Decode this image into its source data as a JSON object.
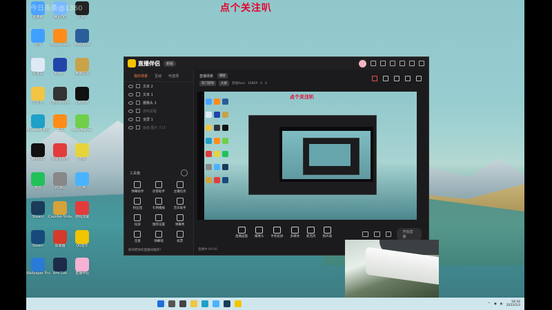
{
  "overlay_text": "点个关注叭",
  "watermark": "今日头条@1360",
  "desktop_icons": [
    {
      "label": "此电脑",
      "color": "#4aa3ff"
    },
    {
      "label": "腾讯QQ",
      "color": "#7ab9ff"
    },
    {
      "label": "CPC",
      "color": "#222"
    },
    {
      "label": "文件",
      "color": "#3fa0ff"
    },
    {
      "label": "DataGuard",
      "color": "#ff8c1a"
    },
    {
      "label": "WeGame",
      "color": "#2a5e9a"
    },
    {
      "label": "回收站",
      "color": "#dfe9f5"
    },
    {
      "label": "Ever...",
      "color": "#2244aa"
    },
    {
      "label": "英雄联盟",
      "color": "#c9a24a"
    },
    {
      "label": "文件夹",
      "color": "#f2c443"
    },
    {
      "label": "OBS Studio",
      "color": "#333"
    },
    {
      "label": "CapCut",
      "color": "#111"
    },
    {
      "label": "Microsoft Edge",
      "color": "#1fa0c9"
    },
    {
      "label": "工具",
      "color": "#ff8c1a"
    },
    {
      "label": "AfterBurner",
      "color": "#6fcf4a"
    },
    {
      "label": "腾讯QQ",
      "color": "#111"
    },
    {
      "label": "网易云音乐",
      "color": "#e23b3b"
    },
    {
      "label": "游戏",
      "color": "#e6d43c"
    },
    {
      "label": "微信",
      "color": "#21c15a"
    },
    {
      "label": "PUBG",
      "color": "#888"
    },
    {
      "label": "应用",
      "color": "#4ab3ff"
    },
    {
      "label": "Steam",
      "color": "#1b3b5a"
    },
    {
      "label": "Counter-Strike",
      "color": "#d4a33a"
    },
    {
      "label": "游戏加速",
      "color": "#e23b3b"
    },
    {
      "label": "Steam",
      "color": "#174a7a"
    },
    {
      "label": "加速器",
      "color": "#d43b2b"
    },
    {
      "label": "QQ音乐",
      "color": "#f0c400"
    },
    {
      "label": "Wallpaper Engine",
      "color": "#2a7bd6"
    },
    {
      "label": "Aim Lab",
      "color": "#1c2b4a"
    },
    {
      "label": "直播伴侣",
      "color": "#f7b1d2"
    }
  ],
  "app": {
    "name": "直播伴侣",
    "version": "新版",
    "left_tabs": [
      "我的场景",
      "互动",
      "可选项"
    ],
    "scenes": [
      {
        "label": "文本 2",
        "dim": false
      },
      {
        "label": "文本 1",
        "dim": false
      },
      {
        "label": "摄像头 1",
        "dim": false
      },
      {
        "label": "游戏进程",
        "dim": true
      },
      {
        "label": "全屏 1",
        "dim": false
      },
      {
        "label": "画面 图片 713",
        "dim": true
      }
    ],
    "tools_title": "工具箱",
    "tools": [
      "弹幕助手",
      "房管助手",
      "主播任务",
      "粉丝团",
      "礼物播报",
      "音乐助手",
      "投屏",
      "推荐设置",
      "弹幕秀",
      "连麦",
      "弹幕墙",
      "投票"
    ],
    "help_text": "如何把你的直播间推荐?",
    "scene_title": "直播场景",
    "chip_label": "横屏",
    "info_row": [
      "热门游戏",
      "大屏",
      "其他Rom",
      "1080P",
      "0",
      "0"
    ],
    "preview_title": "点个关注叭",
    "bottom_tools": [
      "直播画面",
      "摄像头",
      "手机投屏",
      "多媒体",
      "麦克风",
      "扬声器"
    ],
    "start_button": "开始直播",
    "status_text": "直播中 00:00"
  },
  "taskbar": {
    "time": "18:34",
    "date": "2022/5/3"
  }
}
